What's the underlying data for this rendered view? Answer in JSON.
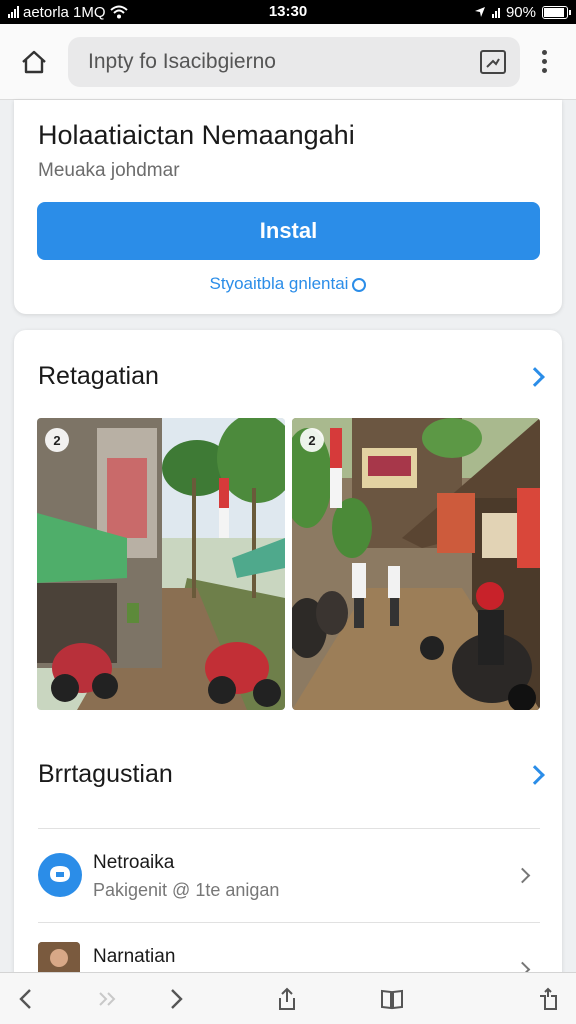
{
  "status_bar": {
    "carrier": "aetorla 1MQ",
    "time": "13:30",
    "battery": "90%",
    "battery_level": 0.9
  },
  "browser": {
    "url": "Inpty fo Isacibgierno"
  },
  "app_card": {
    "title": "Holaatiaictan Nemaangahi",
    "subtitle": "Meuaka johdmar",
    "install_label": "Instal",
    "support_link": "Styoaitbla gnlentai"
  },
  "gallery": {
    "title": "Retagatian",
    "photos": [
      {
        "badge": "2"
      },
      {
        "badge": "2"
      }
    ]
  },
  "list_section": {
    "title": "Brrtagustian",
    "items": [
      {
        "title": "Netroaika",
        "subtitle": "Pakigenit @ 1te anigan"
      },
      {
        "title": "Narnatian",
        "subtitle": ""
      }
    ]
  },
  "colors": {
    "accent": "#2b8de8",
    "page_background": "#eef0f2",
    "card": "#ffffff"
  },
  "icons": [
    "home-icon",
    "bookmark-icon",
    "more-vertical-icon",
    "back-icon",
    "forward-icon",
    "share-icon",
    "book-icon",
    "tabs-icon"
  ]
}
